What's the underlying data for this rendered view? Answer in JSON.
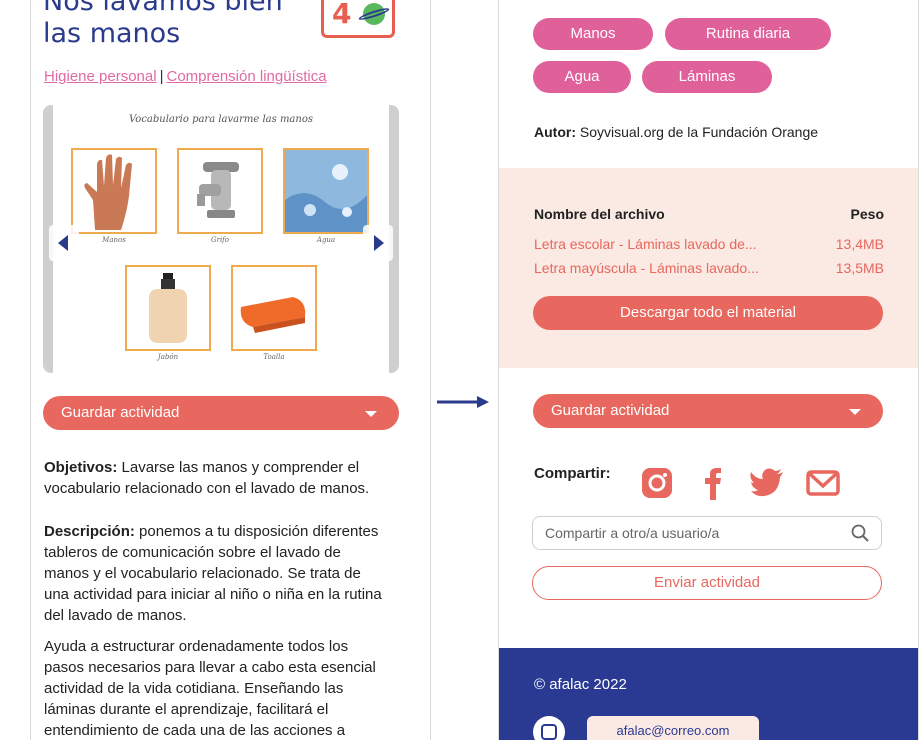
{
  "left": {
    "title": "Nos lavamos bien las manos",
    "age_badge": "4",
    "categories": [
      "Higiene personal",
      "Comprensión lingüística"
    ],
    "sheet_title": "Vocabulario para lavarme las manos",
    "cards": [
      "Manos",
      "Grifo",
      "Agua",
      "Jabón",
      "Toalla"
    ],
    "save_label": "Guardar actividad",
    "objetivos_label": "Objetivos:",
    "objetivos_text": " Lavarse las manos y comprender el vocabulario relacionado con el lavado de manos.",
    "descripcion_label": "Descripción:",
    "descripcion_text": " ponemos a tu disposición diferentes tableros de comunicación sobre el lavado de manos y el vocabulario relacionado. Se trata de una actividad para iniciar al niño o niña en la rutina del lavado de manos.",
    "extra_text": "Ayuda a estructurar ordenadamente todos los pasos necesarios para llevar a cabo esta esencial actividad de la vida cotidiana. Enseñando las láminas durante el aprendizaje, facilitará el entendimiento de cada una de las acciones a"
  },
  "right": {
    "tags": [
      "Manos",
      "Rutina diaria",
      "Agua",
      "Láminas"
    ],
    "author_label": "Autor:",
    "author_value": " Soyvisual.org de la Fundación Orange",
    "files_header_name": "Nombre del archivo",
    "files_header_size": "Peso",
    "files": [
      {
        "name": "Letra escolar - Láminas lavado de...",
        "size": "13,4MB"
      },
      {
        "name": "Letra mayúscula - Láminas lavado...",
        "size": "13,5MB"
      }
    ],
    "download_all": "Descargar todo el material",
    "save_label": "Guardar actividad",
    "share_label": "Compartir:",
    "share_icons": [
      "instagram-icon",
      "facebook-icon",
      "twitter-icon",
      "mail-icon"
    ],
    "search_placeholder": "Compartir a otro/a usuario/a",
    "send_label": "Enviar actividad",
    "footer_copyright": "© afalac 2022",
    "footer_email": "afalac@correo.com"
  },
  "colors": {
    "navy": "#2b3b8c",
    "coral": "#e8675e",
    "pink": "#e0609a",
    "peach": "#fbe9e3",
    "orange_border": "#f0a94d"
  }
}
